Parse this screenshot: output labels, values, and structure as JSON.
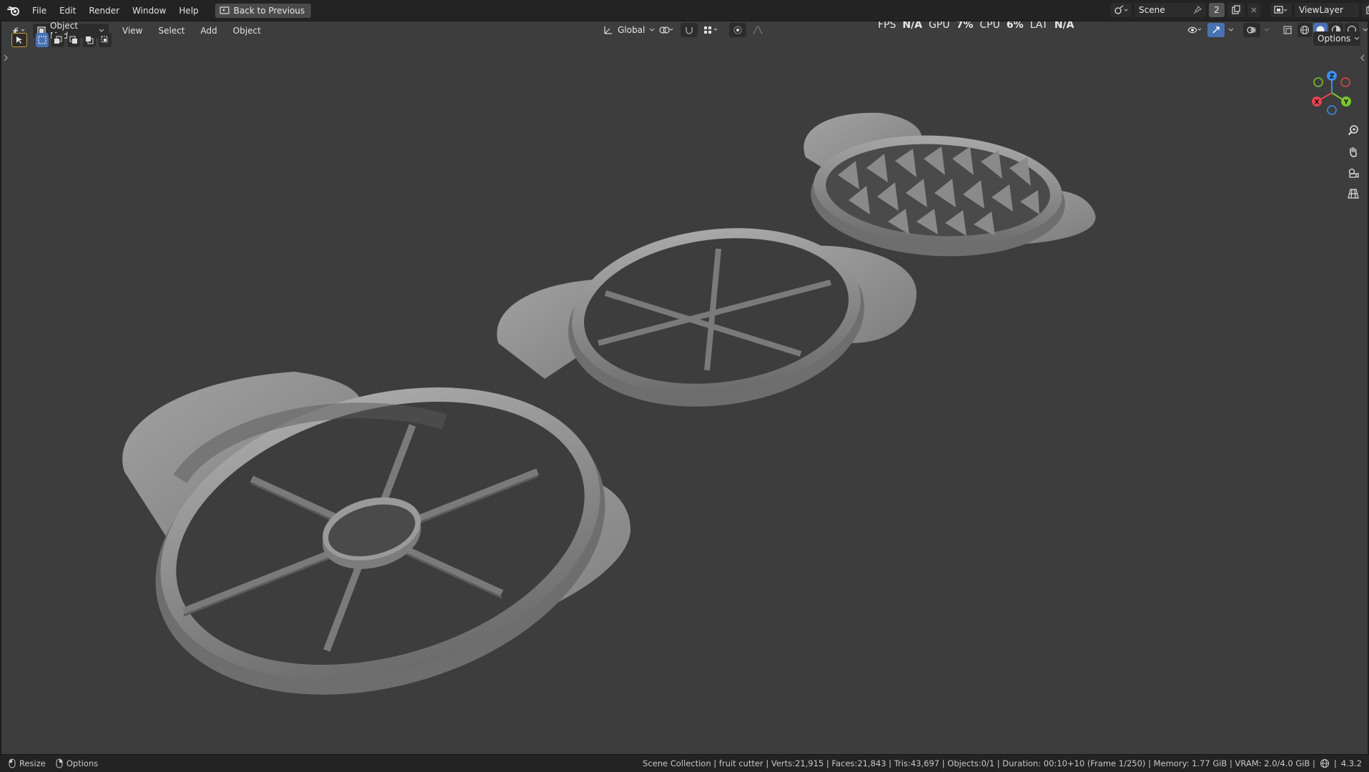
{
  "menubar": {
    "items": [
      "File",
      "Edit",
      "Render",
      "Window",
      "Help"
    ],
    "back_button": "Back to Previous",
    "scene_name": "Scene",
    "scene_count": "2",
    "view_layer": "ViewLayer"
  },
  "header": {
    "mode": "Object Mode",
    "menus": [
      "View",
      "Select",
      "Add",
      "Object"
    ],
    "transform_orientation": "Global",
    "options_label": "Options"
  },
  "perf": {
    "fps_label": "FPS",
    "fps_value": "N/A",
    "gpu_label": "GPU",
    "gpu_value": "7%",
    "cpu_label": "CPU",
    "cpu_value": "6%",
    "lat_label": "LAT",
    "lat_value": "N/A"
  },
  "gizmo": {
    "z": "Z",
    "x": "X",
    "y": "Y"
  },
  "statusbar": {
    "resize_label": "Resize",
    "options_label": "Options",
    "info": "Scene Collection | fruit cutter | Verts:21,915 | Faces:21,843 | Tris:43,697 | Objects:0/1 | Duration: 00:10+10 (Frame 1/250) | Memory: 1.77 GiB | VRAM: 2.0/4.0 GiB |",
    "version": "4.3.2"
  },
  "colors": {
    "viewport_bg": "#3d3d3d",
    "header_bg": "#232323",
    "accent_blue": "#4772b3",
    "axis_x": "#e5434f",
    "axis_y": "#7ac72f",
    "axis_z": "#3b8eea",
    "model_gray": "#8e8e8e"
  }
}
